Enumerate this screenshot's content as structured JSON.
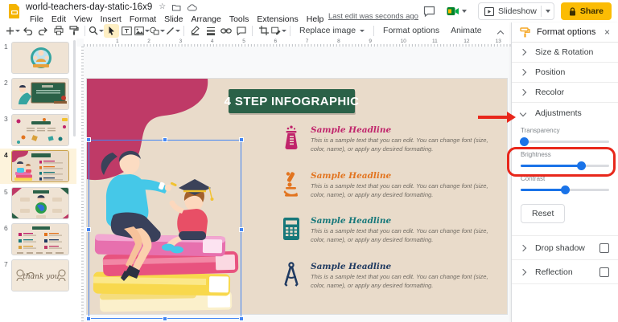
{
  "titlebar": {
    "doc_title": "world-teachers-day-static-16x9",
    "star_icon": "star-icon",
    "menu_items": [
      "File",
      "Edit",
      "View",
      "Insert",
      "Format",
      "Slide",
      "Arrange",
      "Tools",
      "Extensions",
      "Help"
    ],
    "last_edit": "Last edit was seconds ago",
    "slideshow_label": "Slideshow",
    "share_label": "Share"
  },
  "toolbar": {
    "icons": [
      "new-slide",
      "undo",
      "redo",
      "print",
      "paint-format",
      "zoom",
      "select-cursor",
      "text-box",
      "insert-image",
      "insert-shape",
      "insert-line",
      "border-color",
      "line-weight",
      "insert-link",
      "insert-comment",
      "crop-image",
      "mask-image"
    ],
    "selected_tool": "select-cursor",
    "replace_image_label": "Replace image",
    "format_options_label": "Format options",
    "animate_label": "Animate"
  },
  "filmstrip": {
    "selected_slide": 4,
    "slides": [
      {
        "number": "1"
      },
      {
        "number": "2"
      },
      {
        "number": "3"
      },
      {
        "number": "4"
      },
      {
        "number": "5"
      },
      {
        "number": "6"
      },
      {
        "number": "7"
      }
    ],
    "thumb7_text": "thank you"
  },
  "ruler": {
    "h_ticks": [
      "1",
      "2",
      "3",
      "4",
      "5",
      "6",
      "7",
      "8",
      "9",
      "10",
      "11",
      "12",
      "13"
    ]
  },
  "slide": {
    "title": "4 STEP INFOGRAPHIC",
    "background_color": "#e9dbca",
    "title_bg_color": "#2b6148",
    "blob_color": "#bf3a67",
    "selection_color": "#4285f4",
    "steps": [
      {
        "icon": "beaker-icon",
        "color": "#c0246b",
        "headline": "Sample Headline",
        "body": "This is a sample text that you can edit. You can change font (size, color, name), or apply any desired formatting."
      },
      {
        "icon": "microscope-icon",
        "color": "#e2741f",
        "headline": "Sample Headline",
        "body": "This is a sample text that you can edit. You can change font (size, color, name), or apply any desired formatting."
      },
      {
        "icon": "calculator-icon",
        "color": "#17787a",
        "headline": "Sample Headline",
        "body": "This is a sample text that you can edit. You can change font (size, color, name), or apply any desired formatting."
      },
      {
        "icon": "compass-icon",
        "color": "#1f3a61",
        "headline": "Sample Headline",
        "body": "This is a sample text that you can edit. You can change font (size, color, name), or apply any desired formatting."
      }
    ]
  },
  "panel": {
    "title": "Format options",
    "sections": [
      {
        "label": "Size & Rotation",
        "expanded": false
      },
      {
        "label": "Position",
        "expanded": false
      },
      {
        "label": "Recolor",
        "expanded": false
      },
      {
        "label": "Adjustments",
        "expanded": true
      }
    ],
    "sliders": [
      {
        "label": "Transparency",
        "value": 4
      },
      {
        "label": "Brightness",
        "value": 68
      },
      {
        "label": "Contrast",
        "value": 50
      }
    ],
    "reset_label": "Reset",
    "toggles": [
      {
        "label": "Drop shadow",
        "checked": false
      },
      {
        "label": "Reflection",
        "checked": false
      }
    ],
    "accent_color": "#1a73e8"
  },
  "annotations": {
    "color": "#e8271b",
    "arrow_target": "Adjustments",
    "box_target": "Brightness"
  }
}
